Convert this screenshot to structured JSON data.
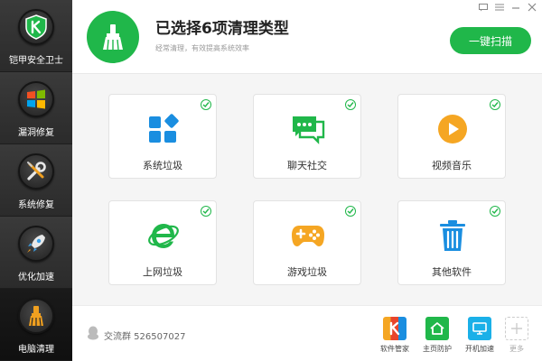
{
  "colors": {
    "accent": "#20b74a",
    "sidebar": "#2b2b2b",
    "check": "#20b74a"
  },
  "sidebar": {
    "items": [
      {
        "label": "铠甲安全卫士",
        "icon": "shield-k-icon",
        "active": false
      },
      {
        "label": "漏洞修复",
        "icon": "windows-logo-icon",
        "active": false
      },
      {
        "label": "系统修复",
        "icon": "wrench-screwdriver-icon",
        "active": false
      },
      {
        "label": "优化加速",
        "icon": "rocket-icon",
        "active": false
      },
      {
        "label": "电脑清理",
        "icon": "broom-icon",
        "active": true
      }
    ]
  },
  "header": {
    "title": "已选择6项清理类型",
    "subtitle": "经常清理，有效提高系统效率",
    "scan_label": "一键扫描",
    "logo_icon": "broom-icon"
  },
  "window_controls": [
    "feedback-icon",
    "menu-icon",
    "minimize-icon",
    "close-icon"
  ],
  "cards": [
    {
      "label": "系统垃圾",
      "icon": "tiles-icon",
      "checked": true
    },
    {
      "label": "聊天社交",
      "icon": "chat-bubbles-icon",
      "checked": true
    },
    {
      "label": "视频音乐",
      "icon": "play-icon",
      "checked": true
    },
    {
      "label": "上网垃圾",
      "icon": "ie-browser-icon",
      "checked": true
    },
    {
      "label": "游戏垃圾",
      "icon": "gamepad-icon",
      "checked": true
    },
    {
      "label": "其他软件",
      "icon": "trash-icon",
      "checked": true
    }
  ],
  "footer": {
    "qq_group": "交流群 526507027",
    "tools": [
      {
        "label": "软件管家",
        "icon": "software-k-icon"
      },
      {
        "label": "主页防护",
        "icon": "home-shield-icon"
      },
      {
        "label": "开机加速",
        "icon": "monitor-icon"
      },
      {
        "label": "更多",
        "icon": "plus-icon"
      }
    ]
  }
}
